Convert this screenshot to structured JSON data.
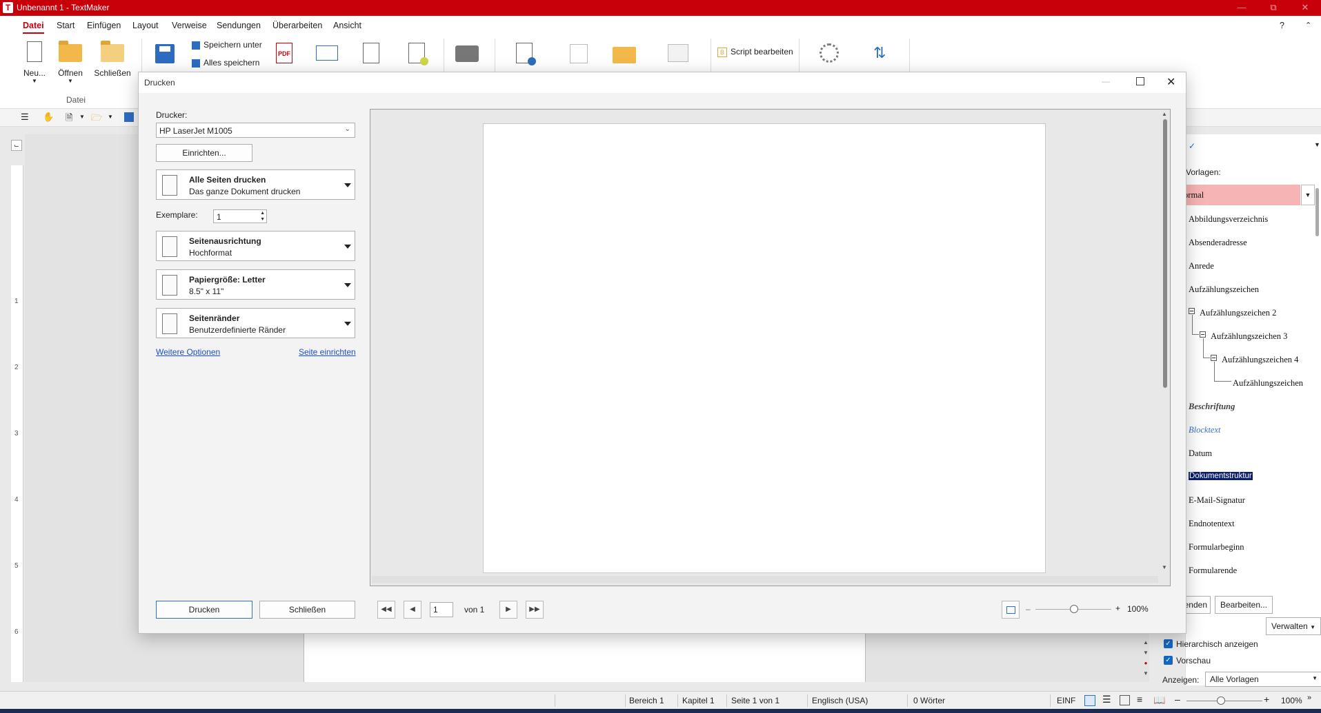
{
  "window": {
    "app_logo": "T",
    "title": "Unbenannt 1 - TextMaker",
    "accent": "#c8000a"
  },
  "menu": {
    "items": [
      "Datei",
      "Start",
      "Einfügen",
      "Layout",
      "Verweise",
      "Sendungen",
      "Überarbeiten",
      "Ansicht"
    ],
    "active": "Datei",
    "help": "?"
  },
  "ribbon": {
    "new_label": "Neu...",
    "open_label": "Öffnen",
    "close_label": "Schließen",
    "group_label": "Datei",
    "save_as_label": "Speichern unter",
    "save_all_label": "Alles speichern",
    "script_label": "Script bearbeiten"
  },
  "ruler": {
    "numbers": [
      "1",
      "2",
      "3",
      "4",
      "5",
      "6"
    ]
  },
  "styles_panel": {
    "header": "Vorlagen:",
    "selected": "Normal",
    "items": [
      "Abbildungsverzeichnis",
      "Absenderadresse",
      "Anrede",
      "Aufzählungszeichen",
      "Aufzählungszeichen 2",
      "Aufzählungszeichen 3",
      "Aufzählungszeichen 4",
      "Aufzählungszeichen",
      "Beschriftung",
      "Blocktext",
      "Datum",
      "Dokumentstruktur",
      "E-Mail-Signatur",
      "Endnotentext",
      "Formularbeginn",
      "Formularende"
    ],
    "apply_label": "Anwenden",
    "edit_label": "Bearbeiten...",
    "manage_label": "Verwalten",
    "hierarchical_label": "Hierarchisch anzeigen",
    "preview_label": "Vorschau",
    "show_label": "Anzeigen:",
    "show_value": "Alle Vorlagen"
  },
  "statusbar": {
    "section": "Bereich 1",
    "chapter": "Kapitel 1",
    "page": "Seite 1 von 1",
    "language": "Englisch (USA)",
    "words": "0 Wörter",
    "mode": "EINF",
    "zoom": "100%"
  },
  "dialog": {
    "title": "Drucken",
    "printer_label": "Drucker:",
    "printer_value": "HP LaserJet M1005",
    "setup_button": "Einrichten...",
    "pages_title": "Alle Seiten drucken",
    "pages_sub": "Das ganze Dokument drucken",
    "copies_label": "Exemplare:",
    "copies_value": "1",
    "orientation_title": "Seitenausrichtung",
    "orientation_sub": "Hochformat",
    "paper_title": "Papiergröße: Letter",
    "paper_sub": "8.5\" x 11\"",
    "margins_title": "Seitenränder",
    "margins_sub": "Benutzerdefinierte Ränder",
    "more_options": "Weitere Optionen",
    "page_setup": "Seite einrichten",
    "print_button": "Drucken",
    "close_button": "Schließen",
    "page_value": "1",
    "page_of": "von 1",
    "zoom": "100%"
  }
}
